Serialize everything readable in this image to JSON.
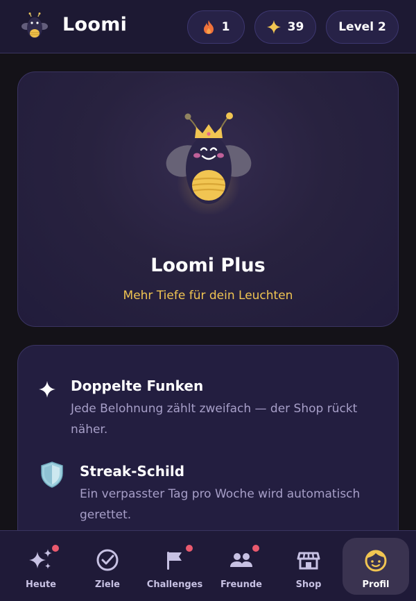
{
  "header": {
    "app_title": "Loomi",
    "logo_icon": "bee-mascot-icon",
    "streak": {
      "icon": "flame-icon",
      "value": "1"
    },
    "sparks": {
      "icon": "sparkle-icon",
      "value": "39"
    },
    "level": {
      "label": "Level 2"
    }
  },
  "hero": {
    "icon": "crowned-bee-mascot-icon",
    "title": "Loomi Plus",
    "subtitle": "Mehr Tiefe für dein Leuchten"
  },
  "features": [
    {
      "icon": "sparkle-icon",
      "title": "Doppelte Funken",
      "desc_line1": "Jede Belohnung zählt zweifach — der Shop rückt",
      "desc_line2": "näher."
    },
    {
      "icon": "shield-icon",
      "title": "Streak-Schild",
      "desc_line1": "Ein verpasster Tag pro Woche wird automatisch",
      "desc_line2": "gerettet."
    }
  ],
  "nav": {
    "items": [
      {
        "label": "Heute",
        "icon": "sparkles-icon",
        "badge": true
      },
      {
        "label": "Ziele",
        "icon": "check-circle-icon",
        "badge": false
      },
      {
        "label": "Challenges",
        "icon": "flag-icon",
        "badge": true
      },
      {
        "label": "Freunde",
        "icon": "friends-icon",
        "badge": true
      },
      {
        "label": "Shop",
        "icon": "shop-icon",
        "badge": false
      },
      {
        "label": "Profil",
        "icon": "profile-face-icon",
        "badge": false,
        "active": true
      }
    ]
  },
  "colors": {
    "background": "#141218",
    "card": "#231e40",
    "accent_gold": "#f1c552",
    "badge_red": "#ea5a6e",
    "muted_text": "#a79fc8"
  }
}
